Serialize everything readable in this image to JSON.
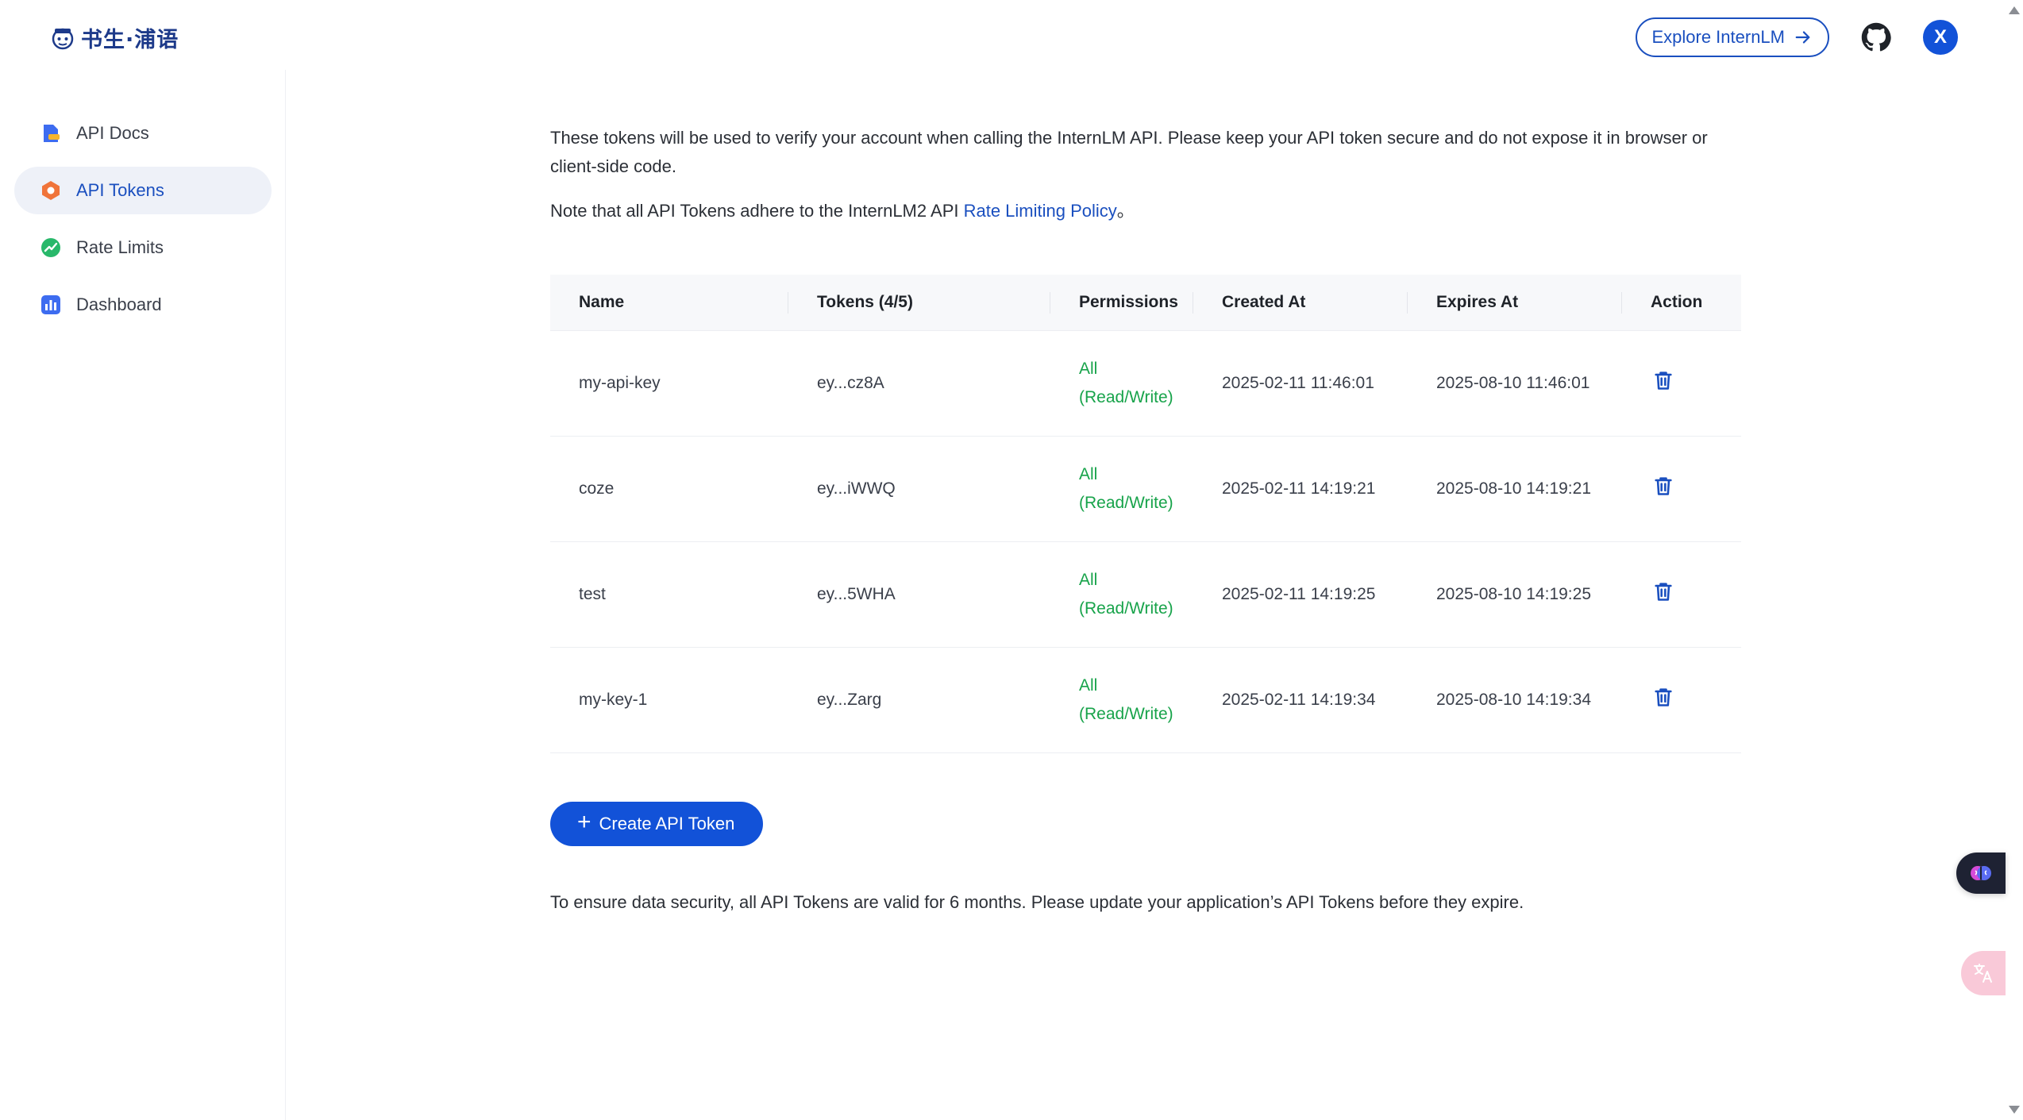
{
  "header": {
    "logo_text": "书生·浦语",
    "explore_label": "Explore InternLM",
    "avatar_initial": "X"
  },
  "sidebar": {
    "items": [
      {
        "label": "API Docs",
        "icon": "document-icon",
        "active": false
      },
      {
        "label": "API Tokens",
        "icon": "hexagon-token-icon",
        "active": true
      },
      {
        "label": "Rate Limits",
        "icon": "trend-icon",
        "active": false
      },
      {
        "label": "Dashboard",
        "icon": "bar-chart-icon",
        "active": false
      }
    ]
  },
  "main": {
    "intro": "These tokens will be used to verify your account when calling the InternLM API. Please keep your API token secure and do not expose it in browser or client-side code.",
    "note_prefix": "Note that all API Tokens adhere to the InternLM2 API ",
    "note_link": "Rate Limiting Policy",
    "note_suffix": "。",
    "table": {
      "headers": [
        "Name",
        "Tokens (4/5)",
        "Permissions",
        "Created At",
        "Expires At",
        "Action"
      ],
      "rows": [
        {
          "name": "my-api-key",
          "token": "ey...cz8A",
          "perm_1": "All",
          "perm_2": "(Read/Write)",
          "created": "2025-02-11 11:46:01",
          "expires": "2025-08-10 11:46:01"
        },
        {
          "name": "coze",
          "token": "ey...iWWQ",
          "perm_1": "All",
          "perm_2": "(Read/Write)",
          "created": "2025-02-11 14:19:21",
          "expires": "2025-08-10 14:19:21"
        },
        {
          "name": "test",
          "token": "ey...5WHA",
          "perm_1": "All",
          "perm_2": "(Read/Write)",
          "created": "2025-02-11 14:19:25",
          "expires": "2025-08-10 14:19:25"
        },
        {
          "name": "my-key-1",
          "token": "ey...Zarg",
          "perm_1": "All",
          "perm_2": "(Read/Write)",
          "created": "2025-02-11 14:19:34",
          "expires": "2025-08-10 14:19:34"
        }
      ]
    },
    "create_label": "Create API Token",
    "footer_note": "To ensure data security, all API Tokens are valid for 6 months. Please update your application’s API Tokens before they expire."
  },
  "colors": {
    "accent": "#1252d8",
    "permission_green": "#17a34a",
    "logo_blue": "#1d3a8a"
  }
}
